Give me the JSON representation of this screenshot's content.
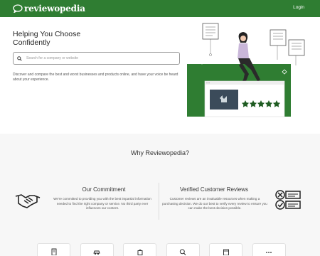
{
  "header": {
    "logo_text": "reviewopedia",
    "login_label": "Login"
  },
  "hero": {
    "title": "Helping You Choose Confidently",
    "search_placeholder": "Search for a company or website",
    "description": "Discover and compare the best and worst businesses and products online, and have your voice be heard about your experience."
  },
  "why": {
    "title": "Why Reviewopedia?",
    "commitment": {
      "title": "Our Commitment",
      "body": "We're committed to providing you with the best impartial information needed to find the right company or service. No third party ever influences our content."
    },
    "verified": {
      "title": "Verified Customer Reviews",
      "body": "Customer reviews are an invaluable resources when making a purchasing decision. We do our best to verify every review to ensure you can make the best decision possible."
    }
  },
  "categories": [
    {
      "icon": "building-icon"
    },
    {
      "icon": "car-icon"
    },
    {
      "icon": "shopping-bag-icon"
    },
    {
      "icon": "magnifier-icon"
    },
    {
      "icon": "store-icon"
    },
    {
      "icon": "more-icon"
    }
  ],
  "colors": {
    "brand_green": "#2f7d32",
    "dark_green": "#1f5c22",
    "text_dark": "#222222"
  }
}
